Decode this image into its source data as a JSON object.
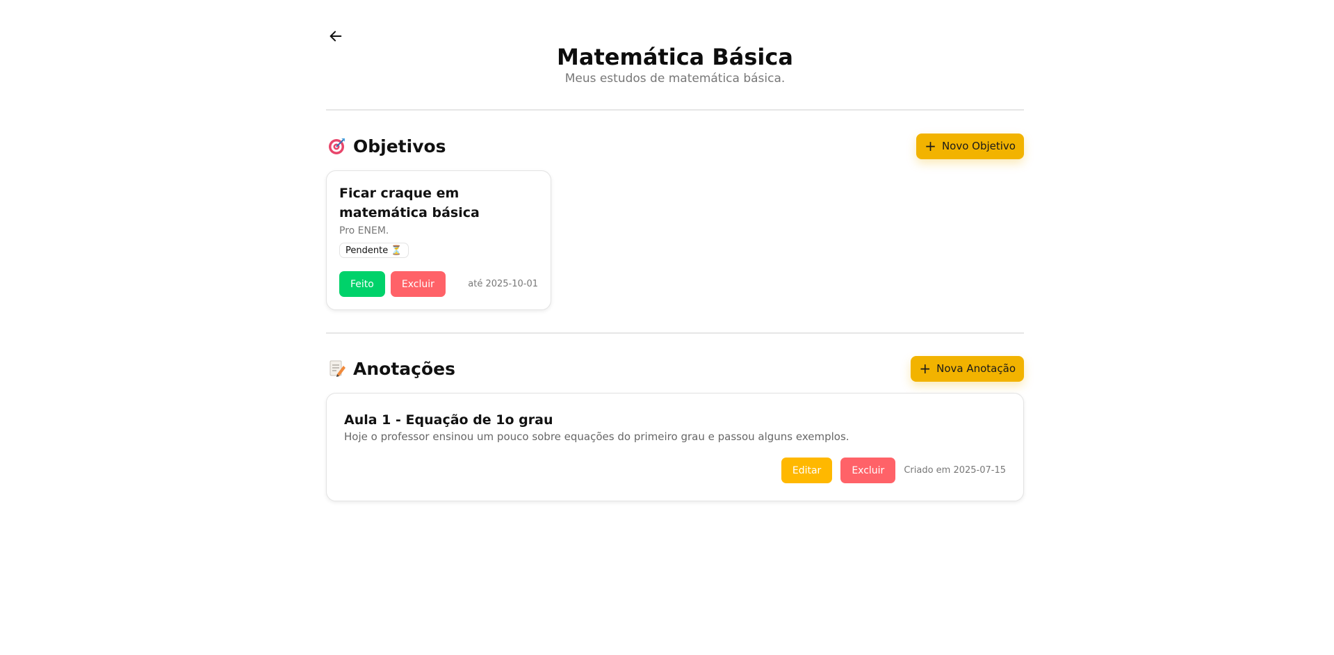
{
  "header": {
    "back_icon": "arrow-left-icon",
    "title": "Matemática Básica",
    "subtitle": "Meus estudos de matemática básica."
  },
  "goals": {
    "section_title": "Objetivos",
    "section_icon": "target-emoji",
    "add_button_label": "Novo Objetivo",
    "items": [
      {
        "title": "Ficar craque em matemática básica",
        "description": "Pro ENEM.",
        "status": "Pendente ⏳",
        "done_label": "Feito",
        "delete_label": "Excluir",
        "due_date": "até 2025-10-01"
      }
    ]
  },
  "notes": {
    "section_title": "Anotações",
    "section_icon": "memo-emoji",
    "add_button_label": "Nova Anotação",
    "items": [
      {
        "title": "Aula 1 - Equação de 1o grau",
        "body": "Hoje o professor ensinou um pouco sobre equações do primeiro grau e passou alguns exemplos.",
        "edit_label": "Editar",
        "delete_label": "Excluir",
        "created": "Criado em 2025-07-15"
      }
    ]
  },
  "colors": {
    "accent": "#f2b300",
    "done": "#00d26a",
    "delete": "#ff6268",
    "edit": "#ffb800"
  }
}
